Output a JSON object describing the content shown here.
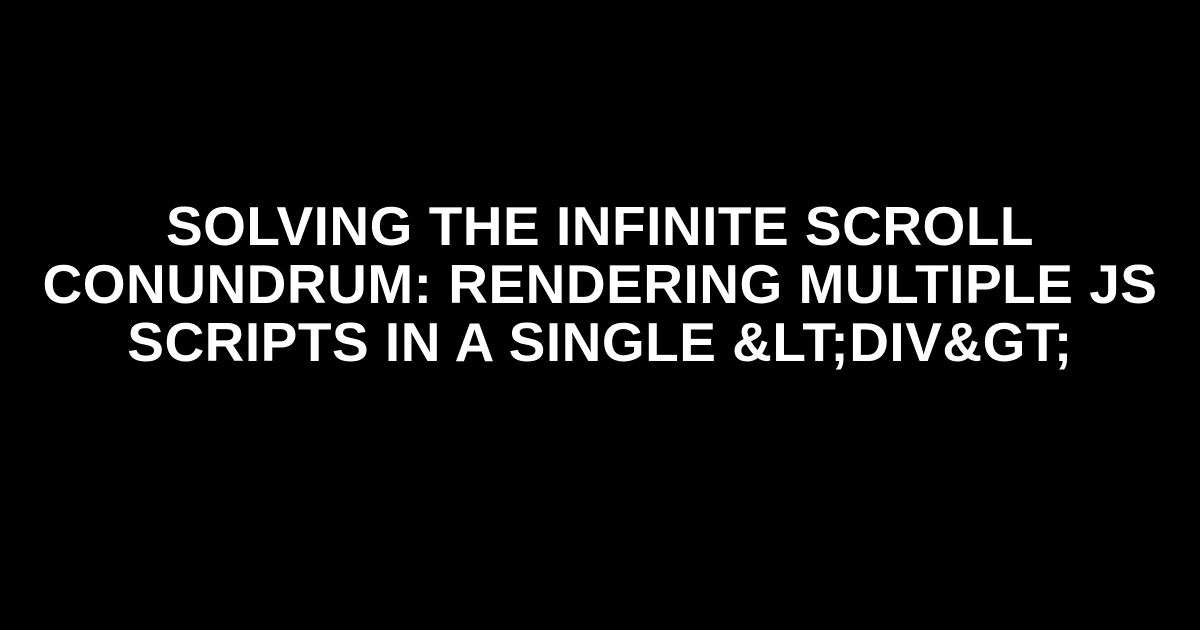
{
  "title": "SOLVING THE INFINITE SCROLL CONUNDRUM: RENDERING MULTIPLE JS SCRIPTS IN A SINGLE &LT;DIV&GT;"
}
